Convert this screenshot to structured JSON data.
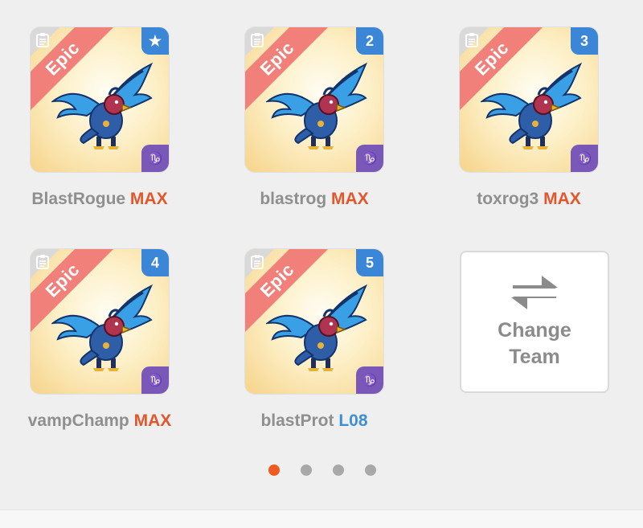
{
  "team": [
    {
      "name": "BlastRogue",
      "level": "MAX",
      "level_type": "max",
      "rarity": "Epic",
      "slot": "★",
      "element_icon": "capricorn-icon",
      "creature_icon": "blue-winged-griffin-creature"
    },
    {
      "name": "blastrog",
      "level": "MAX",
      "level_type": "max",
      "rarity": "Epic",
      "slot": "2",
      "element_icon": "capricorn-icon",
      "creature_icon": "blue-winged-griffin-creature"
    },
    {
      "name": "toxrog3",
      "level": "MAX",
      "level_type": "max",
      "rarity": "Epic",
      "slot": "3",
      "element_icon": "capricorn-icon",
      "creature_icon": "blue-winged-griffin-creature"
    },
    {
      "name": "vampChamp",
      "level": "MAX",
      "level_type": "max",
      "rarity": "Epic",
      "slot": "4",
      "element_icon": "capricorn-icon",
      "creature_icon": "blue-winged-griffin-creature"
    },
    {
      "name": "blastProt",
      "level": "L08",
      "level_type": "level",
      "rarity": "Epic",
      "slot": "5",
      "element_icon": "capricorn-icon",
      "creature_icon": "blue-winged-griffin-creature"
    }
  ],
  "change_team": {
    "line1": "Change",
    "line2": "Team",
    "icon": "swap-arrows-icon"
  },
  "pager": {
    "count": 4,
    "active": 0,
    "active_color": "#f05a1e",
    "inactive_color": "#a9a9a9"
  },
  "colors": {
    "epic_ribbon": "#f2807a",
    "slot_badge": "#3b86d6",
    "element_badge": "#7a58b8",
    "max_text": "#e2562b",
    "level_text": "#3f8fd1",
    "name_text": "#8f8f8f"
  }
}
